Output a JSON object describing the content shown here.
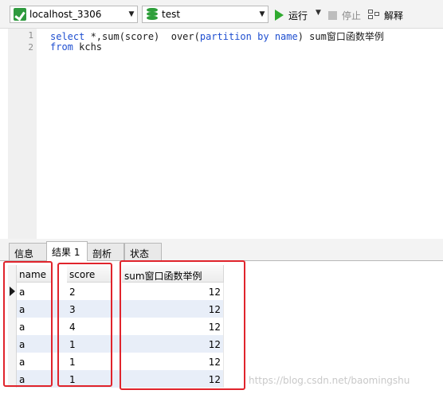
{
  "toolbar": {
    "connection": "localhost_3306",
    "database": "test",
    "run_label": "运行",
    "stop_label": "停止",
    "explain_label": "解释"
  },
  "editor": {
    "line_numbers": [
      "1",
      "2"
    ],
    "lines": [
      {
        "kw1": "select",
        "t1": " *,sum(score)  over(",
        "kw2": "partition",
        "t2": " ",
        "kw3": "by",
        "t3": " ",
        "kw4": "name",
        "t4": ") sum窗口函数举例"
      },
      {
        "kw1": "from",
        "t1": " kchs"
      }
    ]
  },
  "tabs": [
    "信息",
    "结果 1",
    "剖析",
    "状态"
  ],
  "active_tab": "结果 1",
  "grid": {
    "columns": [
      "name",
      "score",
      "sum窗口函数举例"
    ],
    "rows": [
      [
        "a",
        "2",
        "12"
      ],
      [
        "a",
        "3",
        "12"
      ],
      [
        "a",
        "4",
        "12"
      ],
      [
        "a",
        "1",
        "12"
      ],
      [
        "a",
        "1",
        "12"
      ],
      [
        "a",
        "1",
        "12"
      ]
    ]
  },
  "highlight_color": "#e0242c",
  "watermark": "https://blog.csdn.net/baomingshu"
}
